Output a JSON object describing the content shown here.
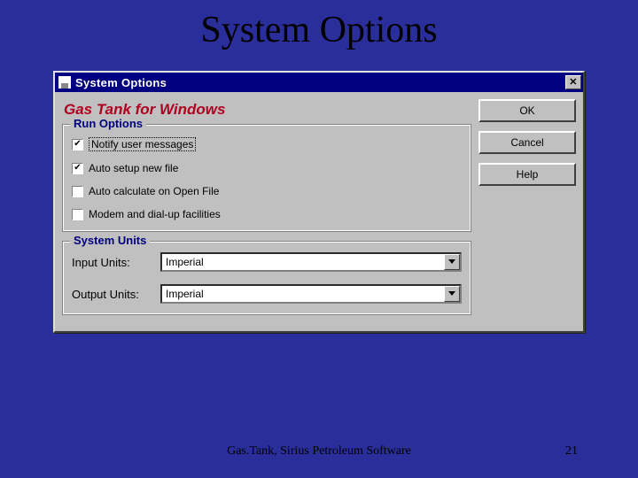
{
  "slide": {
    "title": "System Options",
    "footer_text": "Gas.Tank, Sirius Petroleum Software",
    "page_number": "21"
  },
  "dialog": {
    "title": "System Options",
    "app_name": "Gas Tank for Windows",
    "buttons": {
      "ok": "OK",
      "cancel": "Cancel",
      "help": "Help"
    },
    "close_glyph": "✕",
    "run_options": {
      "legend": "Run Options",
      "items": [
        {
          "label": "Notify user messages",
          "checked": true,
          "focused": true
        },
        {
          "label": "Auto setup new file",
          "checked": true,
          "focused": false
        },
        {
          "label": "Auto calculate on Open File",
          "checked": false,
          "focused": false
        },
        {
          "label": "Modem and dial-up facilities",
          "checked": false,
          "focused": false
        }
      ]
    },
    "system_units": {
      "legend": "System Units",
      "input_label": "Input Units:",
      "input_value": "Imperial",
      "output_label": "Output Units:",
      "output_value": "Imperial"
    }
  }
}
